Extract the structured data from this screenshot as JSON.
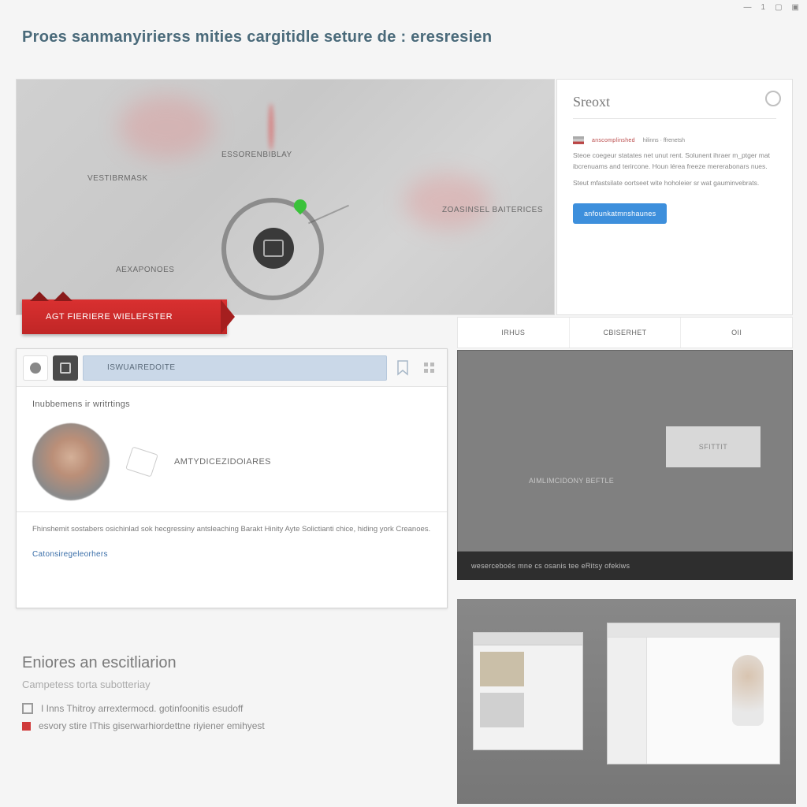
{
  "window": {
    "min": "—",
    "count": "1",
    "max": "▢",
    "close": "▣"
  },
  "page_title": "Proes sanmanyirierss mities cargitidle seture de : eresresien",
  "map": {
    "labels": [
      "ESSORENBIBLAY",
      "VESTIBRMASK",
      "ZOASINSEL baiterices",
      "AEXAPONOES"
    ]
  },
  "sidepanel": {
    "title": "Sreoxt",
    "tag1": "anscomplinshed",
    "tag2": "hilinns · ffrenetsh",
    "p1": "Steoe coegeur statates net unut rent. Solunent ihraer m_ptger mat ibcrenuams and terircone. Houn lérea freeze mererabonars nues.",
    "p2": "Steut mfastsilate oortseet wite hoholeier sr wat gauminvebrats.",
    "button": "anfounkatmnshaunes"
  },
  "banner": {
    "text": "AGT FIERIERE WIELEFSTER"
  },
  "tabs": [
    "IRHUS",
    "CBISERHET",
    "OII"
  ],
  "profile": {
    "search_placeholder": "ISWUAIREDOITE",
    "subtitle": "Inubbemens ir writrtings",
    "user_label": "AMTYDICEZIDOIARES",
    "desc": "Fhinshemit sostabers osichinlad sok hecgressiny antsleaching Barakt Hinity Ayte Solictianti chice, hiding york Creanoes.",
    "link": "Catonsiregeleorhers"
  },
  "darkpanel": {
    "box_label": "SFITTIT",
    "caption": "AIMLIMCIDONY BEFTLE",
    "strip": "weserceboés mne cs osanis tee eRitsy ofekiws"
  },
  "footnotes": {
    "heading": "Eniores an escitliarion",
    "sub": "Campetess torta subotteriay",
    "item1": "I Inns Thitroy arrextermocd. gotinfoonitis esudoff",
    "item2": "esvory stire IThis giserwarhiordettne riyiener emihyest"
  }
}
